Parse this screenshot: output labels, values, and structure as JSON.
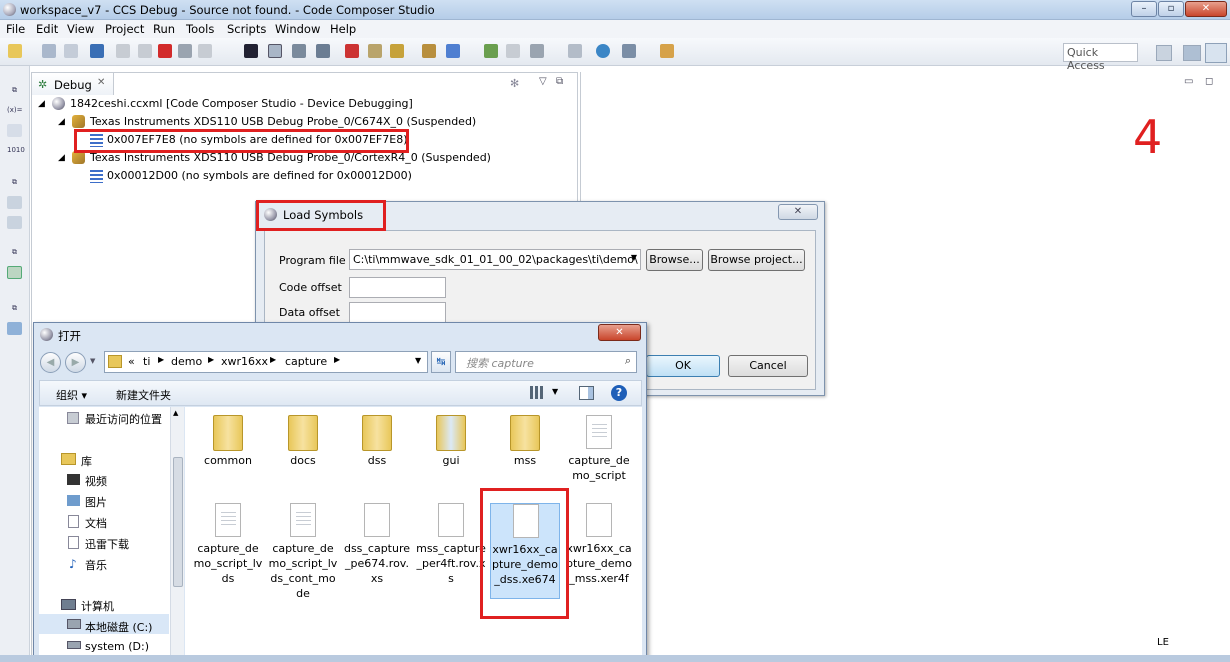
{
  "window": {
    "title": "workspace_v7 - CCS Debug - Source not found. - Code Composer Studio",
    "controls": [
      "–",
      "▫",
      "✕"
    ]
  },
  "menu": [
    "File",
    "Edit",
    "View",
    "Project",
    "Run",
    "Tools",
    "Scripts",
    "Window",
    "Help"
  ],
  "quick_access": "Quick Access",
  "debug_view": {
    "tab_label": "Debug",
    "tree": [
      {
        "label": "1842ceshi.ccxml [Code Composer Studio - Device Debugging]"
      },
      {
        "label": "Texas Instruments XDS110 USB Debug Probe_0/C674X_0 (Suspended)"
      },
      {
        "label": "0x007EF7E8  (no symbols are defined for 0x007EF7E8)"
      },
      {
        "label": "Texas Instruments XDS110 USB Debug Probe_0/CortexR4_0 (Suspended)"
      },
      {
        "label": "0x00012D00  (no symbols are defined for 0x00012D00)"
      }
    ]
  },
  "annotation_number": "4",
  "load_symbols": {
    "title": "Load Symbols",
    "program_file_label": "Program file",
    "program_file_value": "C:\\ti\\mmwave_sdk_01_01_00_02\\packages\\ti\\demo\\",
    "browse": "Browse...",
    "browse_project": "Browse project...",
    "code_offset_label": "Code offset",
    "data_offset_label": "Data offset",
    "ok": "OK",
    "cancel": "Cancel"
  },
  "open_dialog": {
    "title": "打开",
    "breadcrumb": [
      "«",
      "ti",
      "demo",
      "xwr16xx",
      "capture"
    ],
    "search_placeholder": "搜索 capture",
    "organize": "组织 ▾",
    "new_folder": "新建文件夹",
    "nav": [
      "最近访问的位置",
      "库",
      "视频",
      "图片",
      "文档",
      "迅雷下载",
      "音乐",
      "计算机",
      "本地磁盘 (C:)",
      "system (D:)"
    ],
    "files": [
      {
        "name": "common",
        "kind": "folder"
      },
      {
        "name": "docs",
        "kind": "folder"
      },
      {
        "name": "dss",
        "kind": "folder"
      },
      {
        "name": "gui",
        "kind": "folder"
      },
      {
        "name": "mss",
        "kind": "folder"
      },
      {
        "name": "capture_demo_script",
        "kind": "doc"
      },
      {
        "name": "capture_demo_script_lvds",
        "kind": "doc"
      },
      {
        "name": "capture_demo_script_lvds_cont_mode",
        "kind": "doc"
      },
      {
        "name": "dss_capture_pe674.rov.xs",
        "kind": "blank"
      },
      {
        "name": "mss_capture_per4ft.rov.xs",
        "kind": "blank"
      },
      {
        "name": "xwr16xx_capture_demo_dss.xe674",
        "kind": "blank"
      },
      {
        "name": "xwr16xx_capture_demo_mss.xer4f",
        "kind": "blank"
      }
    ]
  },
  "status": {
    "le": "LE"
  }
}
